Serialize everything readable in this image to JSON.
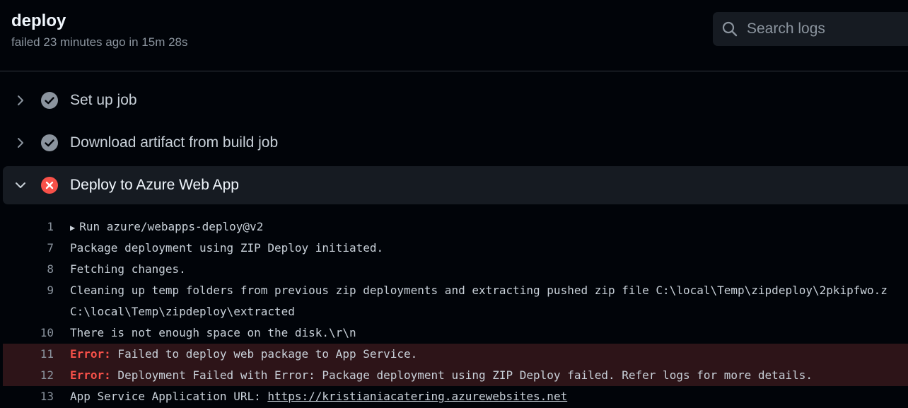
{
  "header": {
    "title": "deploy",
    "meta": "failed 23 minutes ago in 15m 28s",
    "search_placeholder": "Search logs"
  },
  "steps": [
    {
      "label": "Set up job",
      "status": "success",
      "expanded": false
    },
    {
      "label": "Download artifact from build job",
      "status": "success",
      "expanded": false
    },
    {
      "label": "Deploy to Azure Web App",
      "status": "failure",
      "expanded": true
    }
  ],
  "log": {
    "lines": [
      {
        "num": "1",
        "text": "Run azure/webapps-deploy@v2",
        "collapsible": true
      },
      {
        "num": "7",
        "text": "Package deployment using ZIP Deploy initiated."
      },
      {
        "num": "8",
        "text": "Fetching changes."
      },
      {
        "num": "9",
        "text": "Cleaning up temp folders from previous zip deployments and extracting pushed zip file C:\\local\\Temp\\zipdeploy\\2pkipfwo.z"
      },
      {
        "num": "",
        "text": "C:\\local\\Temp\\zipdeploy\\extracted"
      },
      {
        "num": "10",
        "text": "There is not enough space on the disk.\\r\\n"
      },
      {
        "num": "11",
        "error_label": "Error:",
        "text": " Failed to deploy web package to App Service."
      },
      {
        "num": "12",
        "error_label": "Error:",
        "text": " Deployment Failed with Error: Package deployment using ZIP Deploy failed. Refer logs for more details."
      },
      {
        "num": "13",
        "text": "App Service Application URL: ",
        "link": "https://kristianiacatering.azurewebsites.net"
      }
    ]
  },
  "colors": {
    "background": "#010409",
    "success_icon": "#8b949e",
    "failure_icon": "#f85149",
    "error_row": "#2d1418"
  }
}
